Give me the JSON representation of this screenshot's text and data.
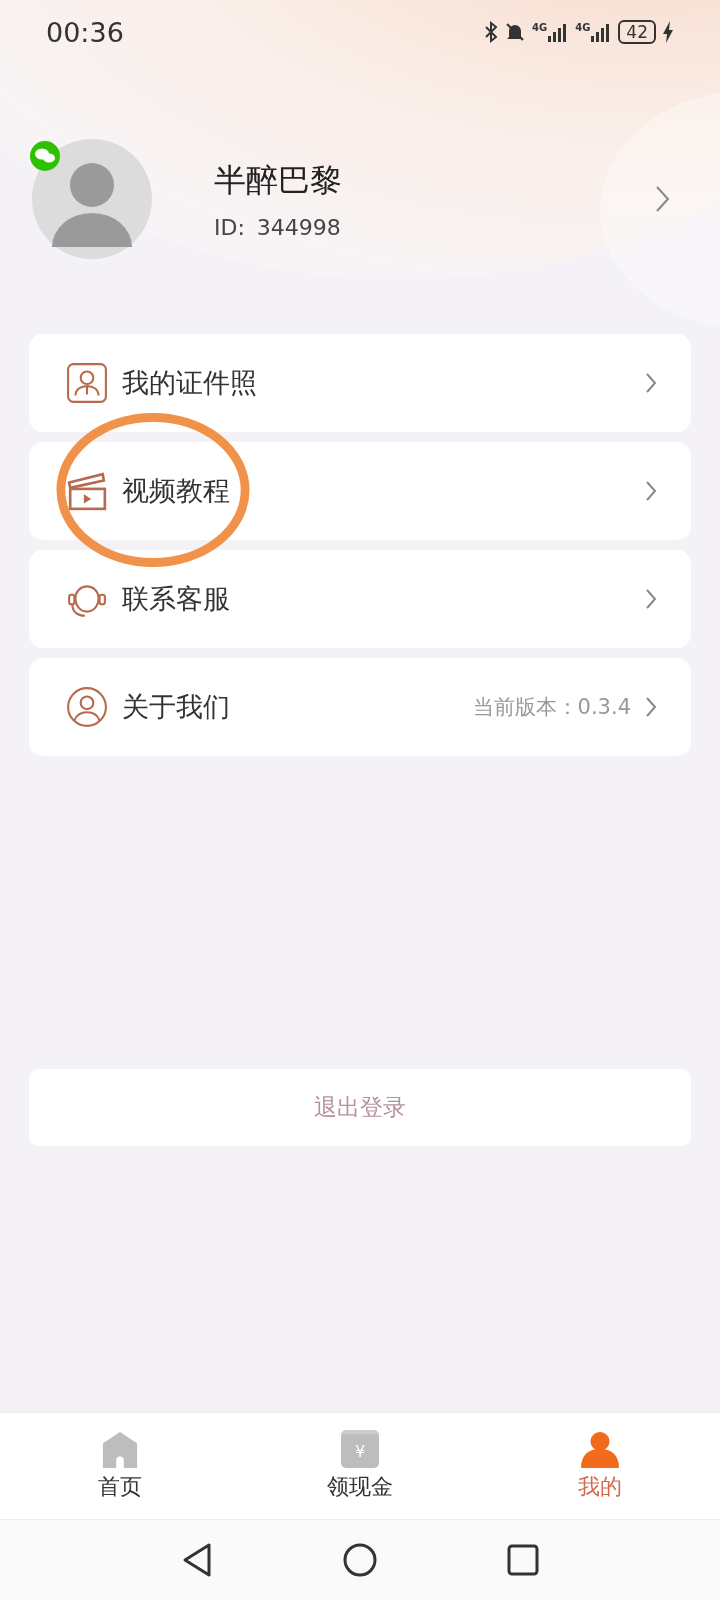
{
  "status_bar": {
    "time": "00:36",
    "networks": [
      "4G",
      "4G"
    ],
    "battery": "42"
  },
  "profile": {
    "name": "半醉巴黎",
    "id_label": "ID:",
    "id_value": "344998"
  },
  "menu": [
    {
      "kind": "id-photo",
      "label": "我的证件照",
      "circled": false
    },
    {
      "kind": "video",
      "label": "视频教程",
      "circled": true
    },
    {
      "kind": "service",
      "label": "联系客服",
      "circled": false
    },
    {
      "kind": "about",
      "label": "关于我们",
      "detail": "当前版本：0.3.4",
      "circled": false
    }
  ],
  "logout": "退出登录",
  "tabs": [
    {
      "kind": "home",
      "label": "首页",
      "selected": false
    },
    {
      "kind": "cash",
      "label": "领现金",
      "glyph": "¥",
      "selected": false
    },
    {
      "kind": "me",
      "label": "我的",
      "selected": true
    }
  ]
}
